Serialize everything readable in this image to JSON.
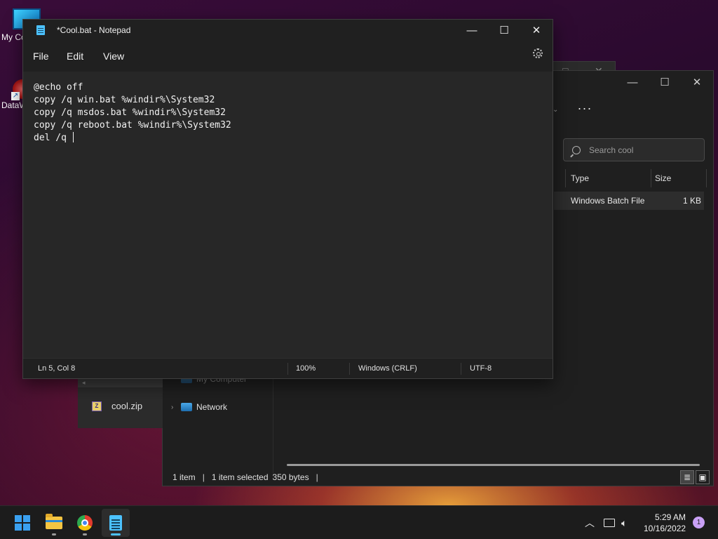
{
  "desktop": {
    "icons": [
      {
        "label": "My Co"
      },
      {
        "label": "DataW"
      }
    ]
  },
  "explorer": {
    "search_placeholder": "Search cool",
    "columns": [
      "Type",
      "Size"
    ],
    "row": {
      "type": "Windows Batch File",
      "size": "1 KB"
    },
    "nav": [
      {
        "label": "My Computer"
      },
      {
        "label": "Network"
      }
    ],
    "status": {
      "items": "1 item",
      "selected": "1 item selected",
      "bytes": "350 bytes"
    }
  },
  "zip_window": {
    "file": "cool.zip"
  },
  "notepad": {
    "title": "*Cool.bat - Notepad",
    "menu": [
      "File",
      "Edit",
      "View"
    ],
    "content_lines": [
      "@echo off",
      "copy /q win.bat %windir%\\System32",
      "copy /q msdos.bat %windir%\\System32",
      "copy /q reboot.bat %windir%\\System32",
      "del /q "
    ],
    "status": {
      "position": "Ln 5, Col 8",
      "zoom": "100%",
      "line_ending": "Windows (CRLF)",
      "encoding": "UTF-8"
    }
  },
  "taskbar": {
    "apps": [
      "start-icon",
      "file-explorer-icon",
      "chrome-icon",
      "notepad-icon"
    ],
    "time": "5:29 AM",
    "date": "10/16/2022",
    "notifications": "1"
  },
  "colors": {
    "accent": "#4cc2ff",
    "window_bg": "#272727",
    "titlebar_bg": "#202020"
  }
}
